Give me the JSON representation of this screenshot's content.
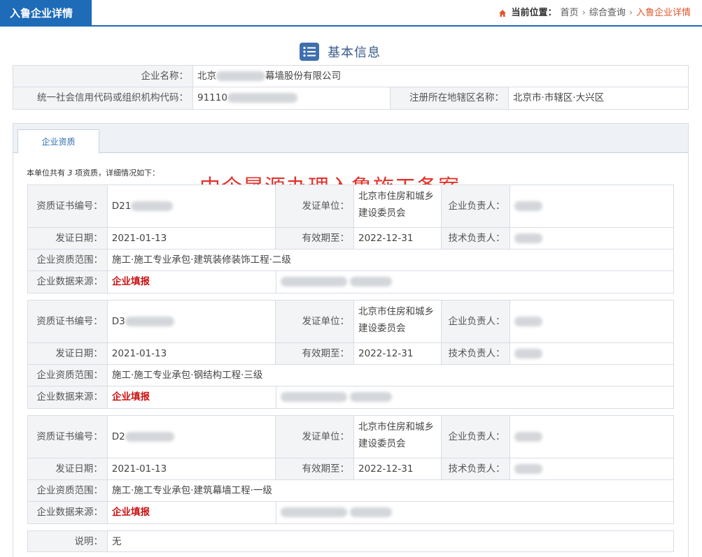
{
  "header": {
    "title": "入鲁企业详情",
    "breadcrumb_label": "当前位置：",
    "breadcrumb": [
      "首页",
      "综合查询",
      "入鲁企业详情"
    ]
  },
  "section": {
    "title": "基本信息"
  },
  "basic_info": {
    "company_name_label": "企业名称：",
    "company_name": "北京",
    "company_name_tail": "幕墙股份有限公司",
    "credit_code_label": "统一社会信用代码或组织机构代码：",
    "credit_code": "91110",
    "region_label": "注册所在地辖区名称：",
    "region": "北京市·市辖区·大兴区"
  },
  "tab": {
    "label": "企业资质"
  },
  "summary": {
    "prefix": "本单位共有 ",
    "count": "3",
    "suffix": " 项资质，详细情况如下："
  },
  "watermark": "中企晟源办理入鲁施工备案",
  "labels": {
    "cert_no": "资质证书编号：",
    "issuer": "发证单位：",
    "legal_person": "企业负责人：",
    "issue_date": "发证日期：",
    "valid_until": "有效期至：",
    "tech_person": "技术负责人：",
    "scope": "企业资质范围：",
    "source": "企业数据来源："
  },
  "qualifications": [
    {
      "cert_no": "D21",
      "issuer": "北京市住房和城乡建设委员会",
      "issue_date": "2021-01-13",
      "valid_until": "2022-12-31",
      "scope": "施工·施工专业承包·建筑装修装饰工程·二级",
      "source": "企业填报"
    },
    {
      "cert_no": "D3",
      "issuer": "北京市住房和城乡建设委员会",
      "issue_date": "2021-01-13",
      "valid_until": "2022-12-31",
      "scope": "施工·施工专业承包·钢结构工程·三级",
      "source": "企业填报"
    },
    {
      "cert_no": "D2",
      "issuer": "北京市住房和城乡建设委员会",
      "issue_date": "2021-01-13",
      "valid_until": "2022-12-31",
      "scope": "施工·施工专业承包·建筑幕墙工程·一级",
      "source": "企业填报"
    }
  ],
  "note": {
    "label": "说明：",
    "value": "无"
  }
}
